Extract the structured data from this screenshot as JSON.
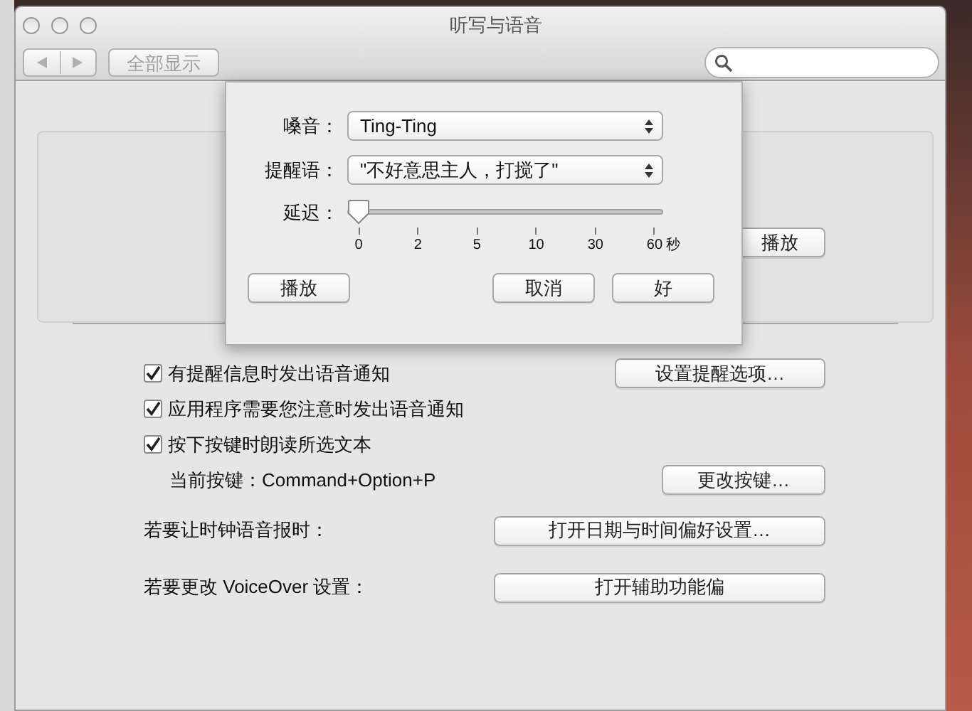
{
  "window": {
    "title": "听写与语音"
  },
  "toolbar": {
    "show_all_button": "全部显示"
  },
  "background_panel": {
    "play_button": "播放"
  },
  "options": [
    {
      "label": "有提醒信息时发出语音通知",
      "checked": true,
      "button": "设置提醒选项…"
    },
    {
      "label": "应用程序需要您注意时发出语音通知",
      "checked": true
    },
    {
      "label": "按下按键时朗读所选文本",
      "checked": true
    }
  ],
  "current_key": {
    "text": "当前按键：Command+Option+P",
    "button": "更改按键…"
  },
  "shortcuts": [
    {
      "label": "若要让时钟语音报时：",
      "button": "打开日期与时间偏好设置…"
    },
    {
      "label": "若要更改 VoiceOver 设置：",
      "button": "打开辅助功能偏"
    }
  ],
  "sheet": {
    "fields": [
      {
        "label": "嗓音：",
        "value": "Ting-Ting"
      },
      {
        "label": "提醒语：",
        "value": "\"不好意思主人，打搅了\""
      }
    ],
    "delay": {
      "label": "延迟：",
      "level": 0,
      "ticks": [
        "0",
        "2",
        "5",
        "10",
        "30",
        "60"
      ],
      "unit": "秒"
    },
    "left_button": "播放",
    "right_buttons": [
      "取消",
      "好"
    ]
  }
}
